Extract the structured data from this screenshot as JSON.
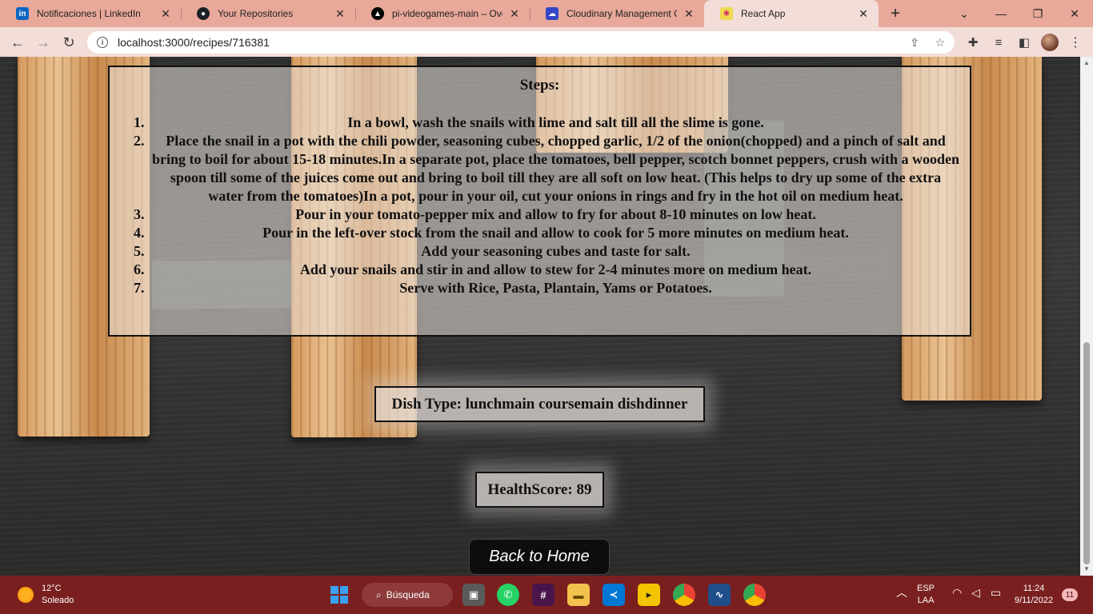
{
  "browser": {
    "tabs": [
      {
        "title": "Notificaciones | LinkedIn",
        "icon": "linkedin-icon"
      },
      {
        "title": "Your Repositories",
        "icon": "github-icon"
      },
      {
        "title": "pi-videogames-main – Overv",
        "icon": "vercel-icon"
      },
      {
        "title": "Cloudinary Management Con",
        "icon": "cloudinary-icon"
      },
      {
        "title": "React App",
        "icon": "react-app-icon"
      }
    ],
    "url": "localhost:3000/recipes/716381"
  },
  "page": {
    "steps_title": "Steps:",
    "steps": [
      {
        "num": "1.",
        "text": "In a bowl, wash the snails with lime and salt till all the slime is gone."
      },
      {
        "num": "2.",
        "text": "Place the snail in a pot with the chili powder, seasoning cubes, chopped garlic, 1/2 of the onion(chopped) and a pinch of salt and bring to boil for about 15-18 minutes.In a separate pot, place the tomatoes, bell pepper, scotch bonnet peppers, crush with a wooden spoon till some of the juices come out and bring to boil till they are all soft on low heat. (This helps to dry up some of the extra water from the tomatoes)In a pot, pour in your oil, cut your onions in rings and fry in the hot oil on medium heat."
      },
      {
        "num": "3.",
        "text": "Pour in your tomato-pepper mix and allow to fry for about 8-10 minutes on low heat."
      },
      {
        "num": "4.",
        "text": "Pour in the left-over stock from the snail and allow to cook for 5 more minutes on medium heat."
      },
      {
        "num": "5.",
        "text": "Add your seasoning cubes and taste for salt."
      },
      {
        "num": "6.",
        "text": "Add your snails and stir in and allow to stew for 2-4 minutes more on medium heat."
      },
      {
        "num": "7.",
        "text": "Serve with Rice, Pasta, Plantain, Yams or Potatoes."
      }
    ],
    "dish_type": "Dish Type: lunchmain coursemain dishdinner",
    "health_score": "HealthScore: 89",
    "back_button": "Back to Home"
  },
  "taskbar": {
    "weather_temp": "12°C",
    "weather_desc": "Soleado",
    "search_label": "Búsqueda",
    "lang_top": "ESP",
    "lang_bottom": "LAA",
    "time": "11:24",
    "date": "9/11/2022",
    "notifications": "11"
  },
  "colors": {
    "tabstrip": "#e8a89a",
    "toolbar": "#f3ddd8",
    "taskbar": "#7a1f1f",
    "back_button_bg": "#0d0d0d"
  }
}
